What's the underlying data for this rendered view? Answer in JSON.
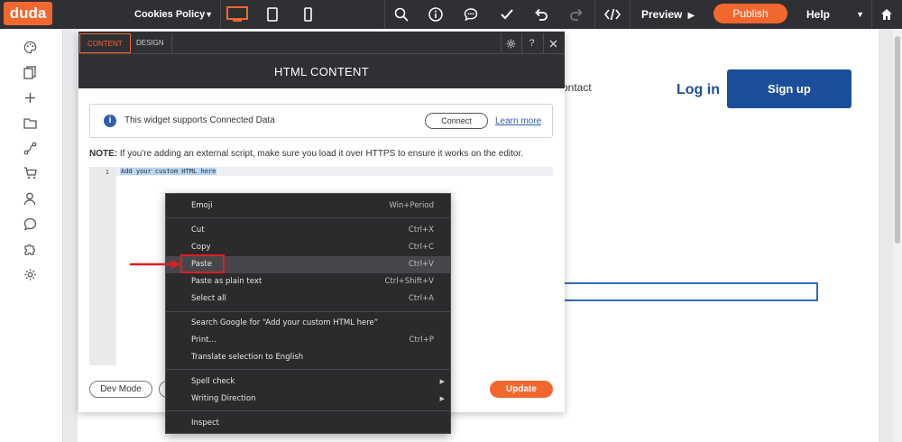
{
  "topbar": {
    "logo": "duda",
    "page_selector": "Cookies Policy",
    "preview_label": "Preview",
    "publish_label": "Publish",
    "help_label": "Help"
  },
  "site": {
    "contact_link": "ontact",
    "login_label": "Log in",
    "signup_label": "Sign up"
  },
  "panel": {
    "tabs": [
      "CONTENT",
      "DESIGN"
    ],
    "help_symbol": "?",
    "title": "HTML CONTENT",
    "notice_text": "This widget supports Connected Data",
    "connect_label": "Connect",
    "learn_more_label": "Learn more",
    "note_label": "NOTE:",
    "note_text": " If you're adding an external script, make sure you load it over HTTPS to ensure it works on the editor.",
    "line_number": "1",
    "code_placeholder": "Add your custom HTML here",
    "dev_mode_label": "Dev Mode",
    "update_label": "Update"
  },
  "context_menu": {
    "items": [
      {
        "label": "Emoji",
        "shortcut": "Win+Period"
      },
      {
        "label": "Cut",
        "shortcut": "Ctrl+X"
      },
      {
        "label": "Copy",
        "shortcut": "Ctrl+C"
      },
      {
        "label": "Paste",
        "shortcut": "Ctrl+V"
      },
      {
        "label": "Paste as plain text",
        "shortcut": "Ctrl+Shift+V"
      },
      {
        "label": "Select all",
        "shortcut": "Ctrl+A"
      },
      {
        "label": "Search Google for “Add your custom HTML here”",
        "shortcut": ""
      },
      {
        "label": "Print...",
        "shortcut": "Ctrl+P"
      },
      {
        "label": "Translate selection to English",
        "shortcut": ""
      },
      {
        "label": "Spell check",
        "shortcut": ""
      },
      {
        "label": "Writing Direction",
        "shortcut": ""
      },
      {
        "label": "Inspect",
        "shortcut": ""
      }
    ]
  },
  "colors": {
    "brand_orange": "#f2672f",
    "topbar_dark": "#2f3033",
    "site_blue": "#1b4f9c",
    "highlight_red": "#e01e1e"
  },
  "icons": {
    "topbar": [
      "desktop-icon",
      "tablet-icon",
      "mobile-icon",
      "search-icon",
      "info-icon",
      "comment-icon",
      "check-icon",
      "undo-icon",
      "redo-icon",
      "code-icon",
      "home-icon"
    ],
    "leftbar": [
      "palette-icon",
      "pages-icon",
      "add-icon",
      "folder-icon",
      "connect-icon",
      "cart-icon",
      "user-icon",
      "chat-icon",
      "puzzle-icon",
      "gear-icon"
    ]
  }
}
